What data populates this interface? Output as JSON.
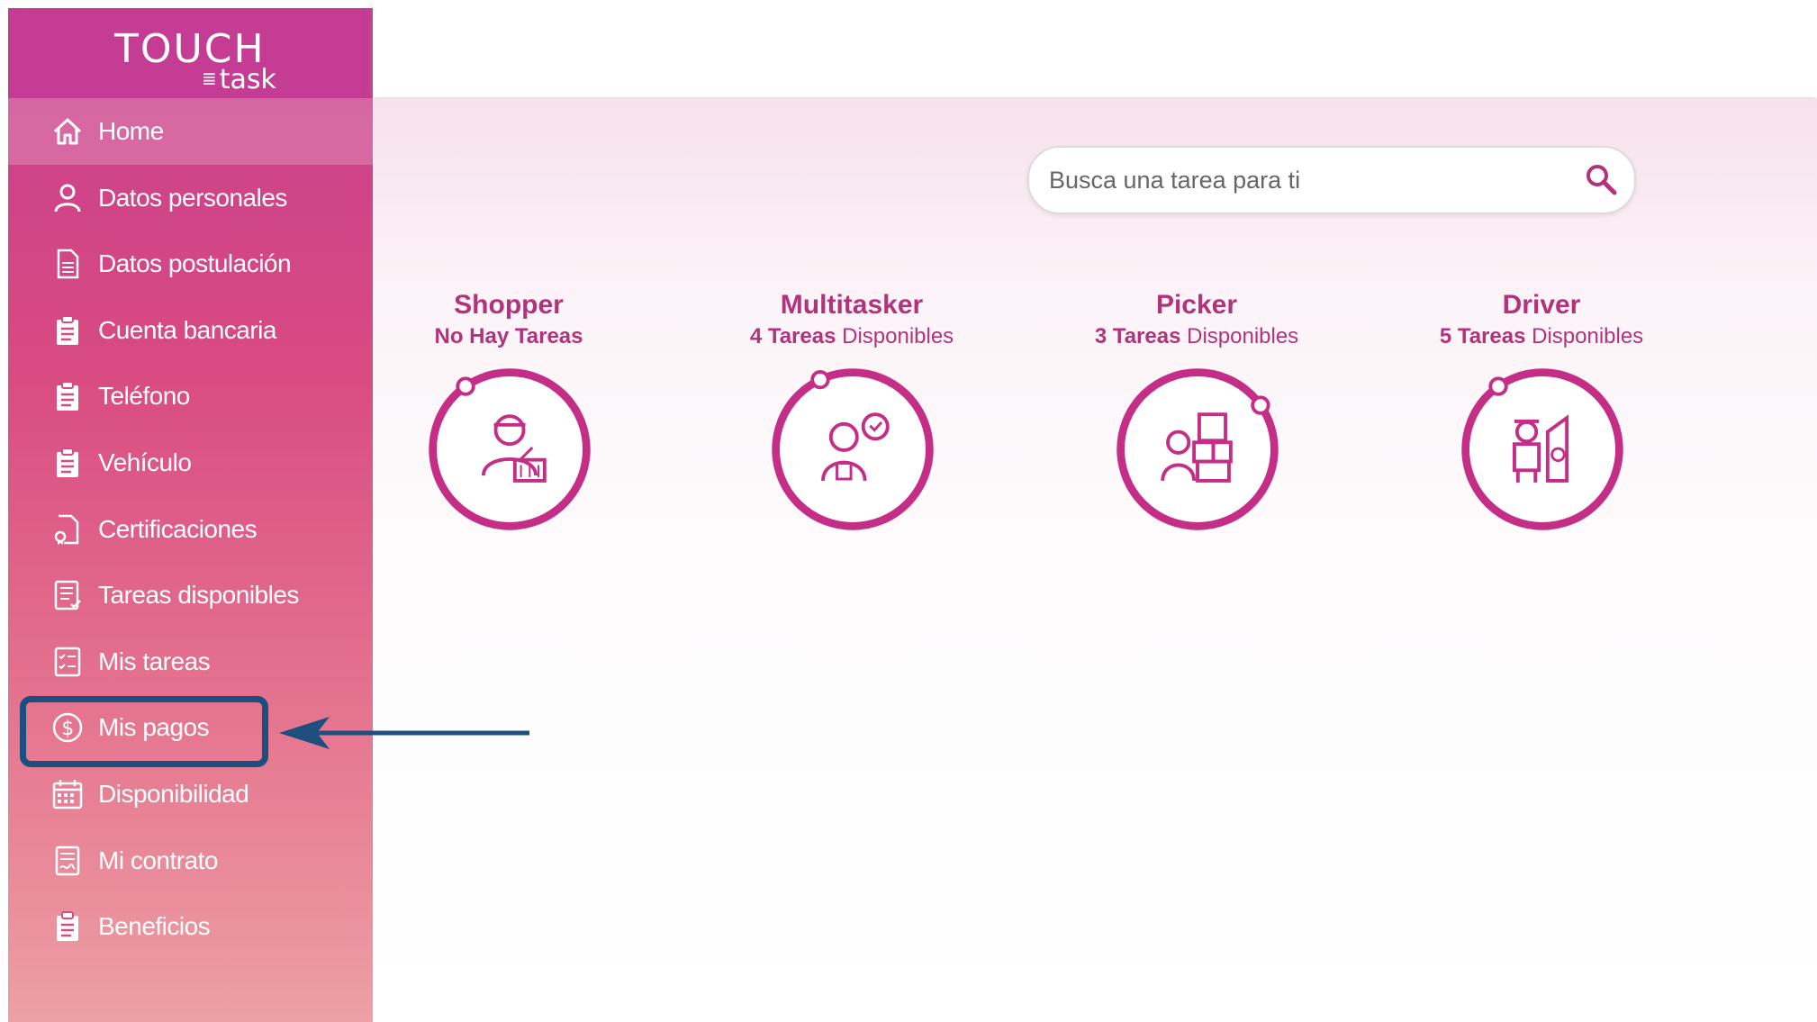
{
  "logo": {
    "line1": "TOUCH",
    "line2": "task"
  },
  "menu": [
    {
      "label": "Home",
      "icon": "home-icon"
    },
    {
      "label": "Datos personales",
      "icon": "user-icon"
    },
    {
      "label": "Datos postulación",
      "icon": "document-icon"
    },
    {
      "label": "Cuenta bancaria",
      "icon": "clipboard-icon"
    },
    {
      "label": "Teléfono",
      "icon": "clipboard-icon"
    },
    {
      "label": "Vehículo",
      "icon": "clipboard-icon"
    },
    {
      "label": "Certificaciones",
      "icon": "certificate-icon"
    },
    {
      "label": "Tareas disponibles",
      "icon": "task-list-icon"
    },
    {
      "label": "Mis tareas",
      "icon": "checklist-icon"
    },
    {
      "label": "Mis pagos",
      "icon": "dollar-icon"
    },
    {
      "label": "Disponibilidad",
      "icon": "calendar-icon"
    },
    {
      "label": "Mi contrato",
      "icon": "contract-icon"
    },
    {
      "label": "Beneficios",
      "icon": "clipboard-icon"
    }
  ],
  "active_menu": "Home",
  "search": {
    "placeholder": "Busca una tarea para ti",
    "icon": "search-icon"
  },
  "cards": [
    {
      "title": "Shopper",
      "count": "No Hay Tareas",
      "suffix": "",
      "icon": "shopper-icon"
    },
    {
      "title": "Multitasker",
      "count": "4 Tareas",
      "suffix": " Disponibles",
      "icon": "multitasker-icon"
    },
    {
      "title": "Picker",
      "count": "3 Tareas",
      "suffix": " Disponibles",
      "icon": "picker-icon"
    },
    {
      "title": "Driver",
      "count": "5 Tareas",
      "suffix": " Disponibles",
      "icon": "driver-icon"
    }
  ],
  "annotation": {
    "highlighted_item": "Mis pagos",
    "color": "#1c4f7d"
  },
  "colors": {
    "brand": "#c43c93",
    "accent_text": "#b2327c",
    "ring": "#c42e86"
  }
}
